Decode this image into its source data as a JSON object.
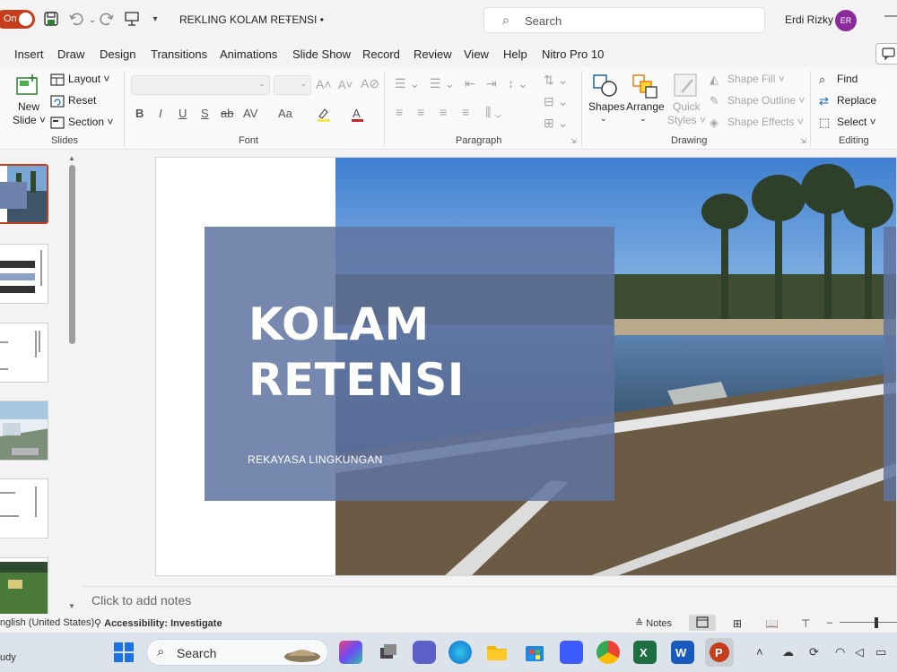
{
  "titlebar": {
    "autosave": "On",
    "doc_title": "REKLING KOLAM RETENSI •",
    "search_placeholder": "Search",
    "user_name": "Erdi Rizky",
    "user_initials": "ER"
  },
  "ribbon_tabs": [
    "Insert",
    "Draw",
    "Design",
    "Transitions",
    "Animations",
    "Slide Show",
    "Record",
    "Review",
    "View",
    "Help",
    "Nitro Pro 10"
  ],
  "ribbon": {
    "slides": {
      "new_slide_1": "New",
      "new_slide_2": "Slide ˅",
      "layout": "Layout ˅",
      "reset": "Reset",
      "section": "Section ˅",
      "label": "Slides"
    },
    "font": {
      "label": "Font",
      "bold": "B",
      "italic": "I",
      "underline": "U",
      "shadow": "S",
      "strike": "ab",
      "spacing": "AV",
      "case": "Aa"
    },
    "paragraph": {
      "label": "Paragraph"
    },
    "drawing": {
      "shapes": "Shapes",
      "arrange": "Arrange",
      "quick_styles_1": "Quick",
      "quick_styles_2": "Styles ˅",
      "shape_fill": "Shape Fill ˅",
      "shape_outline": "Shape Outline ˅",
      "shape_effects": "Shape Effects ˅",
      "label": "Drawing"
    },
    "editing": {
      "find": "Find",
      "replace": "Replace",
      "select": "Select ˅",
      "label": "Editing"
    }
  },
  "slide": {
    "title_line1": "KOLAM",
    "title_line2": "RETENSI",
    "subtitle": "REKAYASA LINGKUNGAN"
  },
  "notes_placeholder": "Click to add notes",
  "statusbar": {
    "language": "nglish (United States)",
    "accessibility": "Accessibility: Investigate",
    "notes": "Notes"
  },
  "taskbar": {
    "left_label": "udy",
    "search_label": "Search"
  },
  "colors": {
    "accent": "#c43e1c",
    "title_box": "#5f73a0",
    "avatar": "#8b2a9a"
  }
}
